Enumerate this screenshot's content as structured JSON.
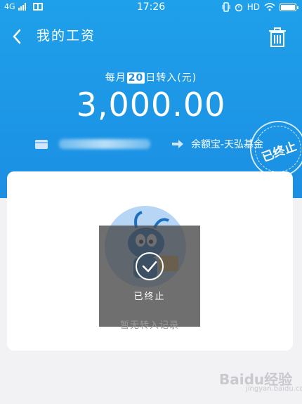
{
  "status_bar": {
    "network": "4G",
    "time": "17:26",
    "hd": "HD"
  },
  "nav": {
    "title": "我的工资"
  },
  "plan": {
    "caption_prefix": "每月",
    "day": "20",
    "caption_suffix": "日转入(元)",
    "amount": "3,000.00",
    "destination": "余额宝-天弘基金",
    "stamp": "已终止"
  },
  "card": {
    "overlay_status": "已终止",
    "empty_text": "暂无转入记录"
  },
  "watermark": {
    "brand": "Baidu经验",
    "sub": "jingyan.baidu.com"
  },
  "colors": {
    "header_blue": "#1b8fe3",
    "background": "#f2f2f4"
  }
}
